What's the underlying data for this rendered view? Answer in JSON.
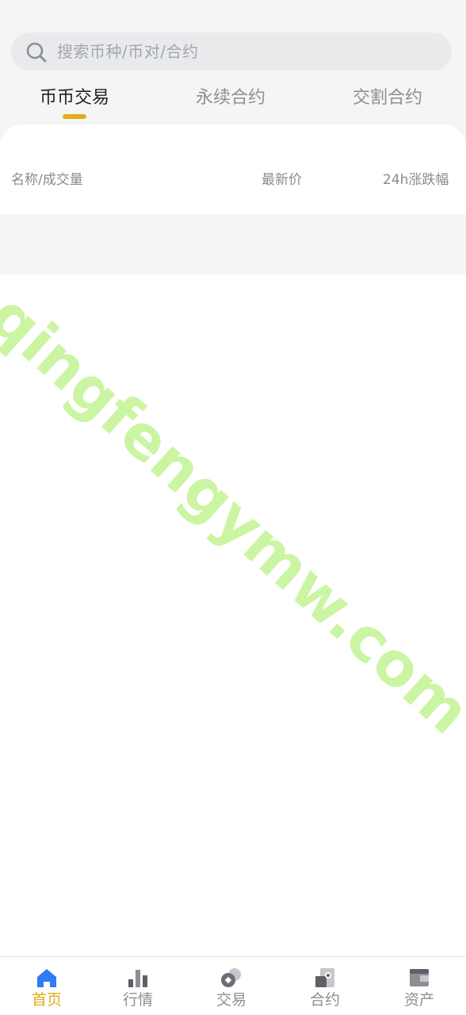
{
  "search": {
    "placeholder": "搜索币种/币对/合约"
  },
  "tabs": [
    {
      "label": "币币交易",
      "active": true
    },
    {
      "label": "永续合约",
      "active": false
    },
    {
      "label": "交割合约",
      "active": false
    }
  ],
  "table": {
    "headers": {
      "name_volume": "名称/成交量",
      "last_price": "最新价",
      "change_24h": "24h涨跌幅"
    }
  },
  "watermark": "qingfengymw.com",
  "bottom_nav": [
    {
      "label": "首页",
      "icon": "home-icon",
      "active": true
    },
    {
      "label": "行情",
      "icon": "market-chart-icon",
      "active": false
    },
    {
      "label": "交易",
      "icon": "trade-coins-icon",
      "active": false
    },
    {
      "label": "合约",
      "icon": "contract-icon",
      "active": false
    },
    {
      "label": "资产",
      "icon": "wallet-icon",
      "active": false
    }
  ],
  "colors": {
    "accent": "#e1ad18",
    "active_nav_icon": "#2f7cf6",
    "watermark": "#c6f59a"
  }
}
